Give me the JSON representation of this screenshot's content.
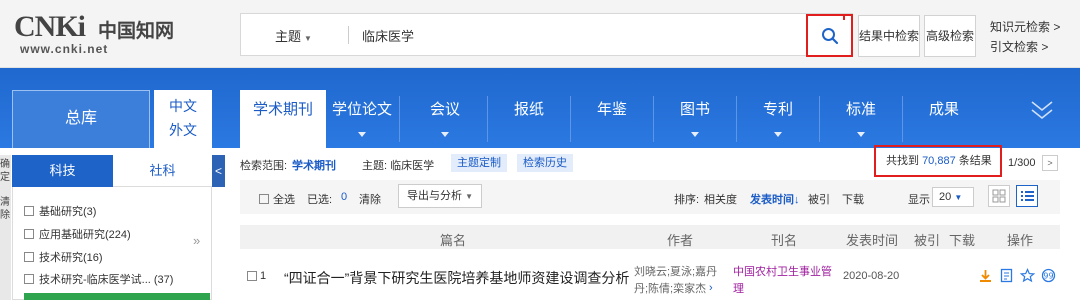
{
  "header": {
    "logo_big": "CNKi",
    "logo_cn": "中国知网",
    "logo_url": "www.cnki.net",
    "search_field": "主题",
    "query": "临床医学",
    "within_results": "结果中检索",
    "advanced_search": "高级检索",
    "knowledge_search": "知识元检索 >",
    "citation_search": "引文检索 >"
  },
  "nav": {
    "total": "总库",
    "lang_zh": "中文",
    "lang_foreign": "外文",
    "tabs": [
      {
        "label": "学术期刊"
      },
      {
        "label": "学位论文"
      },
      {
        "label": "会议"
      },
      {
        "label": "报纸"
      },
      {
        "label": "年鉴"
      },
      {
        "label": "图书"
      },
      {
        "label": "专利"
      },
      {
        "label": "标准"
      },
      {
        "label": "成果"
      }
    ]
  },
  "left": {
    "edge_top": [
      "确",
      "定"
    ],
    "edge_bottom": [
      "清",
      "除"
    ],
    "tab_science": "科技",
    "tab_social": "社科",
    "collapse": "<",
    "categories": [
      "基础研究(3)",
      "应用基础研究(224)",
      "技术研究(16)",
      "技术研究-临床医学试... (37)"
    ]
  },
  "results": {
    "scope_label": "检索范围:",
    "scope_value": "学术期刊",
    "topic_label": "主题: 临床医学",
    "topic_custom": "主题定制",
    "history": "检索历史",
    "found_prefix": "共找到",
    "found_count": "70,887",
    "found_suffix": "条结果",
    "page": "1/300",
    "select_all": "全选",
    "selected_label": "已选:",
    "selected_count": "0",
    "clear": "清除",
    "export": "导出与分析",
    "sort_label": "排序:",
    "sort_relevance": "相关度",
    "sort_date": "发表时间",
    "sort_cited": "被引",
    "sort_download": "下载",
    "display_label": "显示",
    "page_size": "20"
  },
  "table": {
    "headers": [
      "篇名",
      "作者",
      "刊名",
      "发表时间",
      "被引",
      "下载",
      "操作"
    ],
    "rows": [
      {
        "num": "1",
        "title": "“四证合一”背景下研究生医院培养基地师资建设调查分析",
        "author1": "刘晓云;夏泳;嘉丹",
        "author2": "丹;陈倩;栾家杰",
        "journal1": "中国农村卫生事业管",
        "journal2": "理",
        "date": "2020-08-20"
      }
    ]
  },
  "colors": {
    "primary_blue": "#1f68ce",
    "highlight_red": "#e11d1d",
    "journal_purple": "#a020a0"
  }
}
